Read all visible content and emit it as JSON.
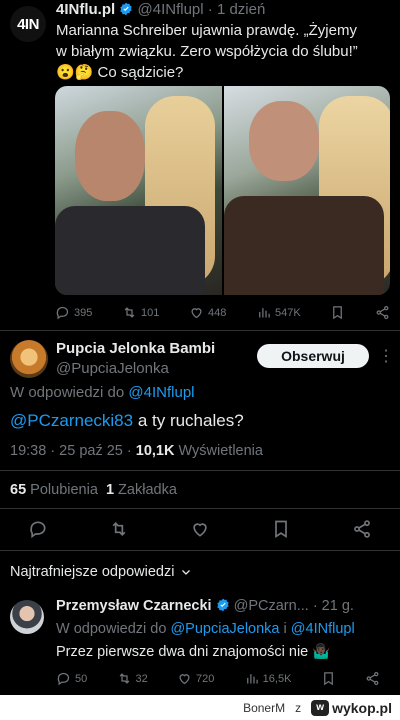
{
  "tweet1": {
    "avatar_text": "4IN",
    "name": "4INflu.pl",
    "handle": "@4INflupl",
    "time": "· 1 dzień",
    "text_line1": "Marianna Schreiber ujawnia prawdę. „Żyjemy",
    "text_line2": "w białym związku. Zero współżycia do ślubu!”",
    "text_line3": "😮🤔 Co sądzicie?",
    "metrics": {
      "replies": "395",
      "reposts": "101",
      "likes": "448",
      "views": "547K"
    }
  },
  "main_reply": {
    "name": "Pupcia Jelonka Bambi",
    "handle": "@PupciaJelonka",
    "follow_label": "Obserwuj",
    "reply_prefix": "W odpowiedzi do",
    "reply_to": "@4INflupl",
    "mention": "@PCzarnecki83",
    "text": " a ty ruchales?",
    "timestamp": "19:38 · 25 paź 25 · ",
    "views": "10,1K",
    "views_label": " Wyświetlenia",
    "likes_count": "65",
    "likes_label": " Polubienia",
    "bookmarks_count": "1",
    "bookmarks_label": " Zakładka"
  },
  "sort": {
    "label": "Najtrafniejsze odpowiedzi"
  },
  "tweet3": {
    "name": "Przemysław Czarnecki",
    "handle": "@PCzarn...",
    "time": "· 21 g.",
    "reply_prefix": "W odpowiedzi do",
    "reply_to_1": "@PupciaJelonka",
    "reply_and": " i ",
    "reply_to_2": "@4INflupl",
    "text": "Przez pierwsze dwa dni znajomości nie 🤷🏿‍♂️",
    "metrics": {
      "replies": "50",
      "reposts": "32",
      "likes": "720",
      "views": "16,5K"
    }
  },
  "watermark": {
    "user": "BonerM",
    "sep": "z",
    "site": "wykop.pl"
  },
  "colors": {
    "background": "#000000",
    "link": "#1d9bf0",
    "muted": "#71767b",
    "verified": "#1d9bf0"
  }
}
